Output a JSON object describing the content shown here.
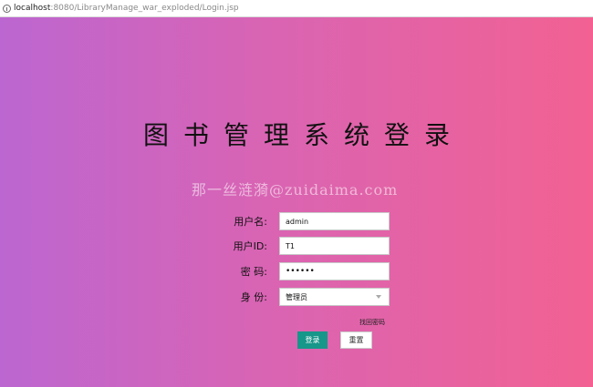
{
  "browser": {
    "url_host": "localhost",
    "url_path": ":8080/LibraryManage_war_exploded/Login.jsp"
  },
  "page": {
    "title": "图书管理系统登录",
    "watermark": "那一丝涟漪@zuidaima.com"
  },
  "form": {
    "username": {
      "label": "用户名:",
      "value": "admin"
    },
    "user_id": {
      "label": "用户ID:",
      "value": "T1"
    },
    "password": {
      "label": "密 码:",
      "value": "••••••"
    },
    "role": {
      "label": "身 份:",
      "value": "管理员"
    },
    "forgot_label": "找回密码",
    "login_label": "登录",
    "reset_label": "重置"
  },
  "colors": {
    "gradient_start": "#bc66d1",
    "gradient_end": "#f26192",
    "login_button": "#17968a"
  },
  "icons": {
    "address_bar": "info-icon",
    "select": "chevron-down-icon"
  }
}
